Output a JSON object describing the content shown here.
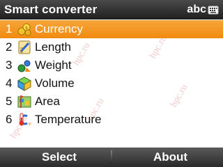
{
  "title_bar": {
    "title": "Smart converter",
    "input_mode": "abc",
    "input_mode_icon": "keyboard-icon"
  },
  "menu": {
    "items": [
      {
        "number": "1",
        "label": "Currency",
        "icon": "coins-icon",
        "selected": true
      },
      {
        "number": "2",
        "label": "Length",
        "icon": "ruler-icon",
        "selected": false
      },
      {
        "number": "3",
        "label": "Weight",
        "icon": "weight-icon",
        "selected": false
      },
      {
        "number": "4",
        "label": "Volume",
        "icon": "cube-icon",
        "selected": false
      },
      {
        "number": "5",
        "label": "Area",
        "icon": "map-icon",
        "selected": false
      },
      {
        "number": "6",
        "label": "Temperature",
        "icon": "thermometer-icon",
        "selected": false
      }
    ]
  },
  "softkeys": {
    "left": "Select",
    "right": "About"
  },
  "watermark": "hpc.ru",
  "colors": {
    "selection": "#f5961e",
    "bar_dark": "#2a2a2a",
    "watermark": "#e58a8a"
  }
}
